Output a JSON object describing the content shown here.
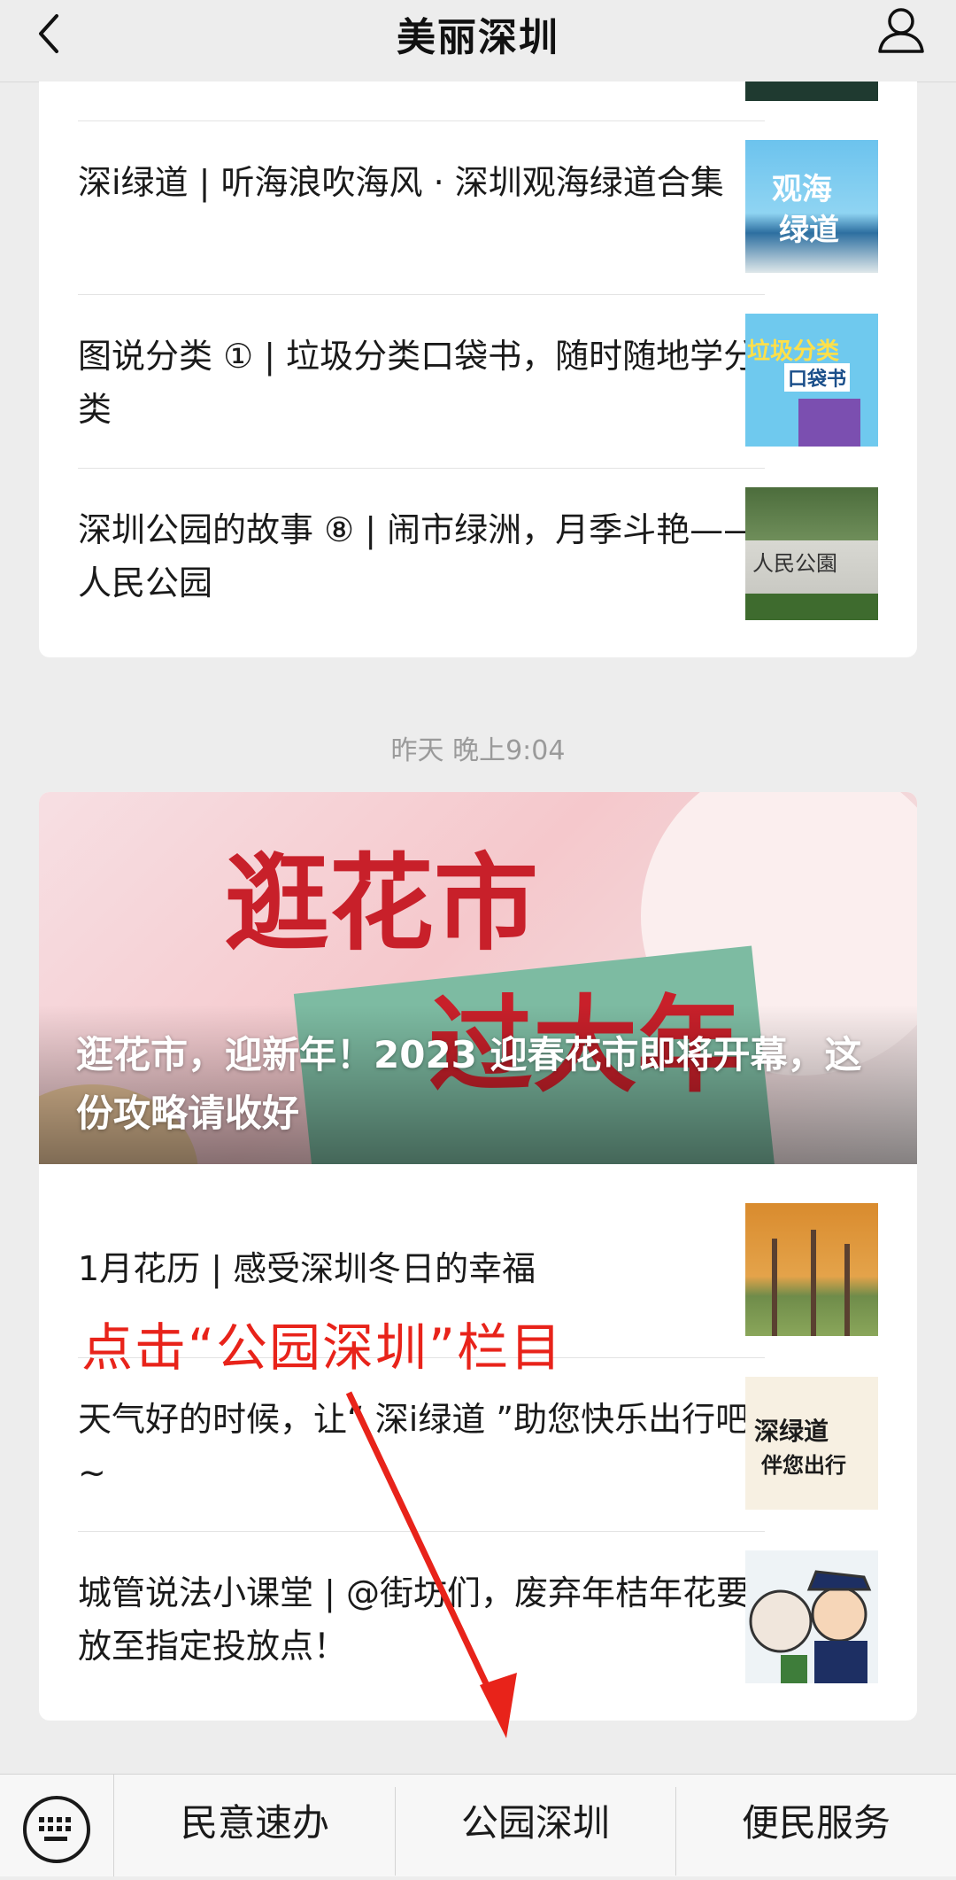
{
  "header": {
    "title": "美丽深圳"
  },
  "feed1": {
    "items": [
      {
        "title": "深i绿道 | 听海浪吹海风 · 深圳观海绿道合集",
        "thumb_label_1": "观海",
        "thumb_label_2": "绿道"
      },
      {
        "title": "图说分类 ① | 垃圾分类口袋书，随时随地学分类",
        "thumb_label_1": "垃圾分类",
        "thumb_label_2": "口袋书"
      },
      {
        "title": "深圳公园的故事 ⑧ | 闹市绿洲，月季斗艳——人民公园",
        "thumb_label_1": "人民公園"
      }
    ]
  },
  "timestamp": "昨天 晚上9:04",
  "feed2": {
    "hero": {
      "title": "逛花市，迎新年！2023 迎春花市即将开幕，这份攻略请收好",
      "image_text_1": "逛花市",
      "image_text_2": "过大年"
    },
    "items": [
      {
        "title": "1月花历 | 感受深圳冬日的幸福"
      },
      {
        "title": "天气好的时候，让“ 深i绿道 ”助您快乐出行吧~",
        "thumb_label_1": "深绿道",
        "thumb_label_2": "伴您出行"
      },
      {
        "title": "城管说法小课堂 | @街坊们，废弃年桔年花要放至指定投放点！"
      }
    ]
  },
  "annotation": {
    "text": "点击“公园深圳”栏目",
    "color": "#e8231a"
  },
  "menu": {
    "items": [
      {
        "label": "民意速办"
      },
      {
        "label": "公园深圳"
      },
      {
        "label": "便民服务"
      }
    ]
  },
  "icons": [
    "back-icon",
    "user-icon",
    "keyboard-icon"
  ]
}
